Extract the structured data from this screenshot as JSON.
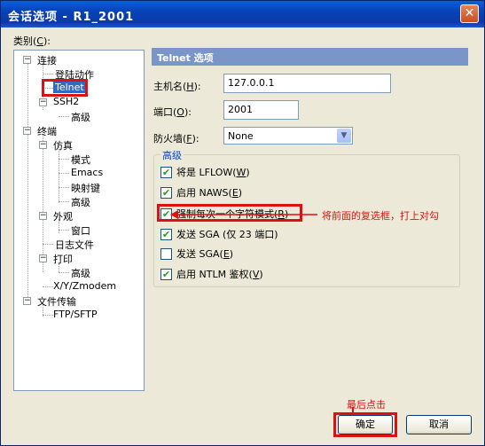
{
  "window": {
    "title": "会话选项 - R1_2001",
    "close_glyph": "✕"
  },
  "category": {
    "label_prefix": "类别(",
    "label_key": "C",
    "label_suffix": "):"
  },
  "tree": {
    "connection": "连接",
    "login_actions": "登陆动作",
    "telnet": "Telnet",
    "ssh2": "SSH2",
    "ssh2_advanced": "高级",
    "terminal": "终端",
    "emulation": "仿真",
    "modes": "模式",
    "emacs": "Emacs",
    "mapped_keys": "映射键",
    "emulation_advanced": "高级",
    "appearance": "外观",
    "window": "窗口",
    "log_file": "日志文件",
    "print": "打印",
    "print_advanced": "高级",
    "xyzmodem": "X/Y/Zmodem",
    "file_transfer": "文件传输",
    "ftp_sftp": "FTP/SFTP",
    "toggle_minus": "−"
  },
  "panel": {
    "header": "Telnet 选项",
    "hostname": {
      "prefix": "主机名(",
      "key": "H",
      "suffix": "):",
      "value": "127.0.0.1"
    },
    "port": {
      "prefix": "端口(",
      "key": "O",
      "suffix": "):",
      "value": "2001"
    },
    "firewall": {
      "prefix": "防火墙(",
      "key": "F",
      "suffix": "):",
      "value": "None",
      "arrow": "▼"
    },
    "advanced_label": "高级",
    "checkboxes": [
      {
        "prefix": "将是 LFLOW(",
        "key": "W",
        "suffix": ")",
        "checked": true
      },
      {
        "prefix": "启用 NAWS(",
        "key": "E",
        "suffix": ")",
        "checked": true
      },
      {
        "prefix": "强制每次一个字符模式(",
        "key": "R",
        "suffix": ")",
        "checked": true
      },
      {
        "prefix": "发送 SGA (仅 23 端口)",
        "key": "",
        "suffix": "",
        "checked": true
      },
      {
        "prefix": "发送 SGA(",
        "key": "E",
        "suffix": ")",
        "checked": false
      },
      {
        "prefix": "启用 NTLM 鉴权(",
        "key": "V",
        "suffix": ")",
        "checked": true
      }
    ],
    "check_glyph": "✔"
  },
  "annotations": {
    "check_note": "将前面的复选框，打上对勾",
    "final_note": "最后点击"
  },
  "buttons": {
    "ok": "确定",
    "cancel": "取消"
  },
  "colors": {
    "accent": "#e01010",
    "header": "#7a96c8",
    "selection": "#316ac5"
  }
}
